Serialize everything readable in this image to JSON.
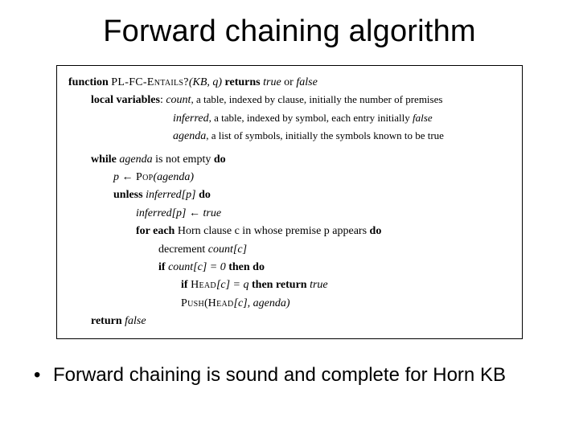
{
  "title": "Forward chaining algorithm",
  "algo": {
    "fn_kw": "function",
    "fn_name": "PL-FC-Entails?",
    "fn_args": "(KB, q)",
    "returns_kw": "returns",
    "ret_true": "true",
    "ret_or": "or",
    "ret_false": "false",
    "locvar_kw": "local variables",
    "lv_count_name": "count",
    "lv_count_desc": ", a table, indexed by clause, initially the number of premises",
    "lv_inferred_name": "inferred",
    "lv_inferred_desc": ", a table, indexed by symbol, each entry initially ",
    "lv_inferred_false": "false",
    "lv_agenda_name": "agenda",
    "lv_agenda_desc": ", a list of symbols, initially the symbols known to be true",
    "while_kw": "while",
    "agenda": "agenda",
    "not_empty": " is not empty ",
    "do_kw": "do",
    "p": "p",
    "assign": " ← ",
    "pop": "Pop",
    "pop_arg": "(agenda)",
    "unless_kw": "unless",
    "inferred_p": " inferred[p] ",
    "inferred_p_assign": "inferred[p] ← true",
    "for_each_kw": "for each",
    "for_each_line": " Horn clause c in whose premise p appears ",
    "decrement": "decrement ",
    "count_c": "count[c]",
    "if_kw": "if",
    "countc_zero": " count[c] = 0 ",
    "then_do": "then do",
    "headc_q": " Head[c] = q ",
    "then_return": "then return",
    "true_word": " true",
    "push": "Push",
    "push_args_open": "(",
    "push_args_head": "Head",
    "push_args_rest": "[c], agenda)",
    "return_kw": "return",
    "false_word": " false"
  },
  "bullet": {
    "dot": "•",
    "text": "Forward chaining is sound and complete for Horn KB"
  }
}
